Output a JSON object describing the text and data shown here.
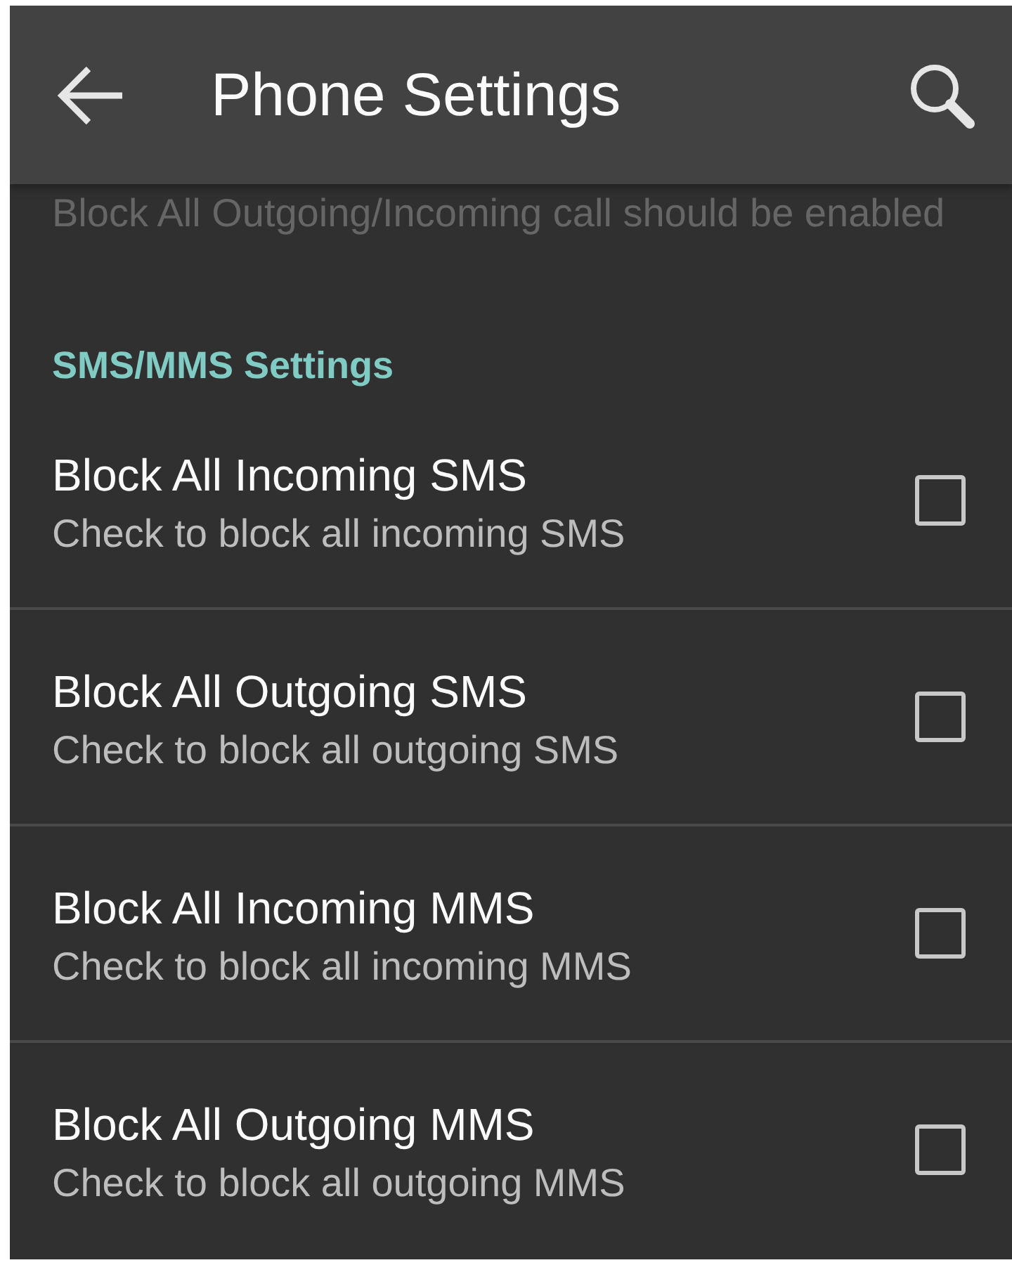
{
  "app_bar": {
    "title": "Phone Settings"
  },
  "clipped_summary": "Block All Outgoing/Incoming call should be enabled",
  "category": {
    "title": "SMS/MMS Settings"
  },
  "preferences": [
    {
      "title": "Block All Incoming SMS",
      "summary": "Check to block all incoming SMS",
      "checked": false
    },
    {
      "title": "Block All Outgoing SMS",
      "summary": "Check to block all outgoing SMS",
      "checked": false
    },
    {
      "title": "Block All Incoming MMS",
      "summary": "Check to block all incoming MMS",
      "checked": false
    },
    {
      "title": "Block All Outgoing MMS",
      "summary": "Check to block all outgoing MMS",
      "checked": false
    }
  ]
}
